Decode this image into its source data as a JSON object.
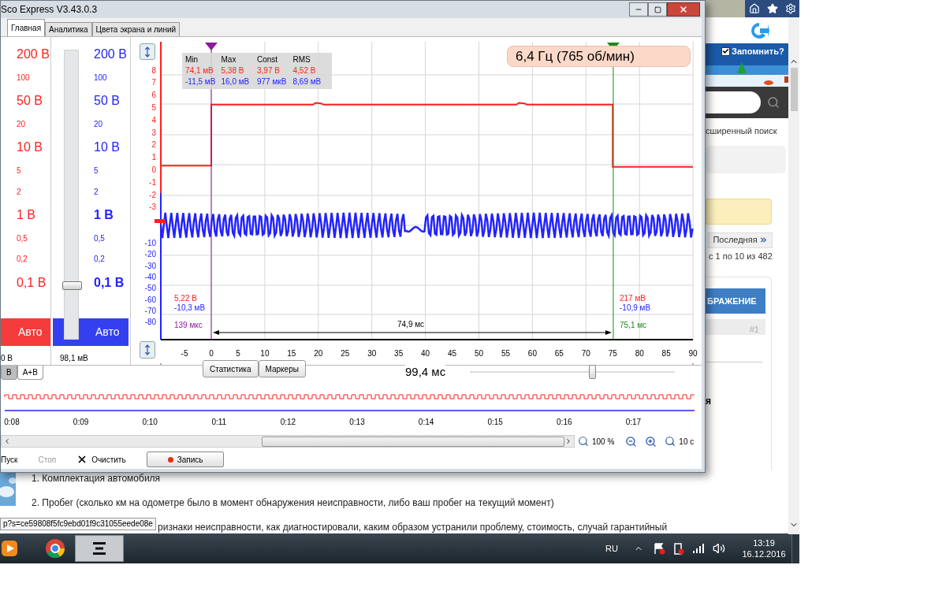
{
  "window": {
    "title": "Sco Express V3.43.0.3"
  },
  "tabs": [
    {
      "label": "Главная",
      "selected": true
    },
    {
      "label": "Аналитика",
      "selected": false
    },
    {
      "label": "Цвета экрана и линий",
      "selected": false
    }
  ],
  "channel_a": {
    "scale": [
      {
        "label": "200 В",
        "major": true,
        "bold": false
      },
      {
        "label": "100",
        "major": false,
        "bold": false
      },
      {
        "label": "50 В",
        "major": true,
        "bold": false
      },
      {
        "label": "20",
        "major": false,
        "bold": false
      },
      {
        "label": "10 В",
        "major": true,
        "bold": false
      },
      {
        "label": "5",
        "major": false,
        "bold": false
      },
      {
        "label": "2",
        "major": false,
        "bold": false
      },
      {
        "label": "1 В",
        "major": true,
        "bold": false
      },
      {
        "label": "0,5",
        "major": false,
        "bold": false
      },
      {
        "label": "0,2",
        "major": false,
        "bold": false
      },
      {
        "label": "0,1 В",
        "major": true,
        "bold": false
      }
    ],
    "auto_label": "Авто",
    "reading": "0 В"
  },
  "channel_b": {
    "scale": [
      {
        "label": "200 В",
        "major": true,
        "bold": false
      },
      {
        "label": "100",
        "major": false,
        "bold": false
      },
      {
        "label": "50 В",
        "major": true,
        "bold": false
      },
      {
        "label": "20",
        "major": false,
        "bold": false
      },
      {
        "label": "10 В",
        "major": true,
        "bold": false
      },
      {
        "label": "5",
        "major": false,
        "bold": false
      },
      {
        "label": "2",
        "major": false,
        "bold": false
      },
      {
        "label": "1 В",
        "major": true,
        "bold": true
      },
      {
        "label": "0,5",
        "major": false,
        "bold": false
      },
      {
        "label": "0,2",
        "major": false,
        "bold": false
      },
      {
        "label": "0,1 В",
        "major": true,
        "bold": true
      }
    ],
    "slider": {
      "level": 0.19
    },
    "auto_label": "Авто",
    "reading": "98,1 мВ"
  },
  "channel_tabs": [
    {
      "label": "B",
      "selected": false
    },
    {
      "label": "A+B",
      "selected": true
    }
  ],
  "plot": {
    "frequency": "6,4 Гц (765 об/мин)",
    "stats": {
      "headers": [
        "Min",
        "Max",
        "Const",
        "RMS"
      ],
      "row_a": [
        "74,1 мВ",
        "5,38 В",
        "3,97 В",
        "4,52 В"
      ],
      "row_b": [
        "-11,5 мВ",
        "16,0 мВ",
        "977 мкВ",
        "8,69 мВ"
      ]
    },
    "y_ticks_a": [
      "8",
      "7",
      "6",
      "5",
      "4",
      "3",
      "2",
      "1",
      "0",
      "-1",
      "-2",
      "-3"
    ],
    "y_ticks_b": [
      "-10",
      "-20",
      "-30",
      "-40",
      "-50",
      "-60",
      "-70",
      "-80"
    ],
    "x_ticks": [
      "-5",
      "0",
      "5",
      "10",
      "15",
      "20",
      "25",
      "30",
      "35",
      "40",
      "45",
      "50",
      "55",
      "60",
      "65",
      "70",
      "75",
      "80",
      "85",
      "90"
    ],
    "marker_1": {
      "value_a": "5,22 В",
      "value_b": "-10,3 мВ",
      "time": "139 мкс"
    },
    "marker_2": {
      "value_a": "217 мВ",
      "value_b": "-10,9 мВ",
      "time": "75,1 мс"
    },
    "interval": "74,9 мс",
    "buttons": [
      "Статистика",
      "Маркеры"
    ],
    "timebase": {
      "label": "99,4 мс",
      "level": 0.6
    }
  },
  "overview": {
    "time_labels": [
      "0:08",
      "0:09",
      "0:10",
      "0:11",
      "0:12",
      "0:13",
      "0:14",
      "0:15",
      "0:16",
      "0:17"
    ]
  },
  "zoom": {
    "percent": "100 %",
    "span": "10 с"
  },
  "toolbar": [
    {
      "kind": "start",
      "label": "Пуск",
      "disabled": false
    },
    {
      "kind": "stop",
      "label": "Стоп",
      "disabled": true
    },
    {
      "kind": "clear",
      "label": "Очистить",
      "disabled": false
    },
    {
      "kind": "record",
      "label": "Запись",
      "disabled": false
    }
  ],
  "web_page": {
    "remember": {
      "label": "Запомнить?",
      "checked": true
    },
    "search_link": "сширенный поиск",
    "last_button": "Последняя",
    "page_info": "с 1 по 10 из 482",
    "section_button": "БРАЖЕНИЕ",
    "post_number": "#1",
    "heading_fragment": "я",
    "lines": [
      "1. Комплектация автомобиля",
      "2. Пробег (сколько км на одометре было в момент обнаружения неисправности, либо ваш пробег на текущий момент)",
      "ризнаки неисправности, как диагностировали, каким образом устранили проблему, стоимость, случай гарантийный"
    ],
    "url_tooltip": "p?s=ce59808f5fc9ebd01f9c31055eede08e"
  },
  "taskbar": {
    "language": "RU",
    "time": "13:19",
    "date": "16.12.2016"
  }
}
